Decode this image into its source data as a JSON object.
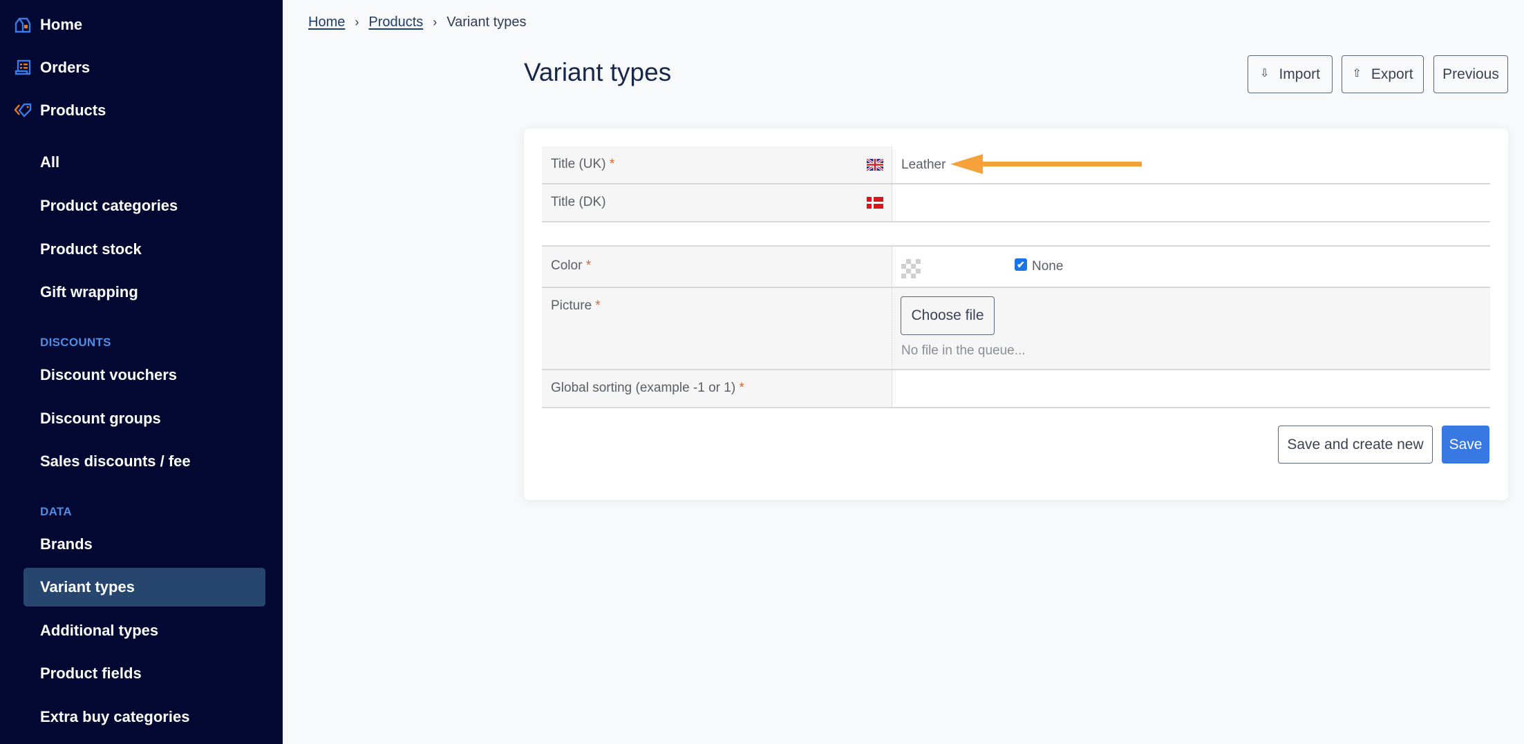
{
  "sidebar": {
    "main_items": [
      {
        "label": "Home",
        "icon": "home-icon"
      },
      {
        "label": "Orders",
        "icon": "orders-icon"
      },
      {
        "label": "Products",
        "icon": "tag-icon"
      }
    ],
    "product_items": [
      {
        "label": "All"
      },
      {
        "label": "Product categories"
      },
      {
        "label": "Product stock"
      },
      {
        "label": "Gift wrapping"
      }
    ],
    "discounts_heading": "DISCOUNTS",
    "discount_items": [
      {
        "label": "Discount vouchers"
      },
      {
        "label": "Discount groups"
      },
      {
        "label": "Sales discounts / fee"
      }
    ],
    "data_heading": "DATA",
    "data_items": [
      {
        "label": "Brands"
      },
      {
        "label": "Variant types",
        "active": true
      },
      {
        "label": "Additional types"
      },
      {
        "label": "Product fields"
      },
      {
        "label": "Extra buy categories"
      }
    ]
  },
  "breadcrumb": {
    "items": [
      "Home",
      "Products"
    ],
    "separator": "›",
    "current": "Variant types"
  },
  "page": {
    "title": "Variant types"
  },
  "header_buttons": {
    "import_label": "Import",
    "import_icon": "⇩",
    "export_label": "Export",
    "export_icon": "⇧",
    "previous_label": "Previous"
  },
  "form": {
    "title_uk": {
      "label": "Title (UK)",
      "required": "*",
      "value": "Leather",
      "flag": "uk-flag-icon"
    },
    "title_dk": {
      "label": "Title (DK)",
      "value": "",
      "flag": "dk-flag-icon"
    },
    "color": {
      "label": "Color",
      "required": "*",
      "none_label": "None",
      "none_checked": true,
      "check_glyph": "✔"
    },
    "picture": {
      "label": "Picture",
      "required": "*",
      "choose_label": "Choose file",
      "queue_text": "No file in the queue..."
    },
    "global_sorting": {
      "label": "Global sorting (example -1 or 1)",
      "required": "*",
      "value": ""
    }
  },
  "footer_buttons": {
    "save_new_label": "Save and create new",
    "save_label": "Save"
  },
  "colors": {
    "sidebar_bg": "#020831",
    "active_item_bg": "#264670",
    "section_heading": "#4f8ee4",
    "primary": "#3778e3",
    "required": "#e4622d",
    "annotation_arrow": "#f7a13a"
  }
}
